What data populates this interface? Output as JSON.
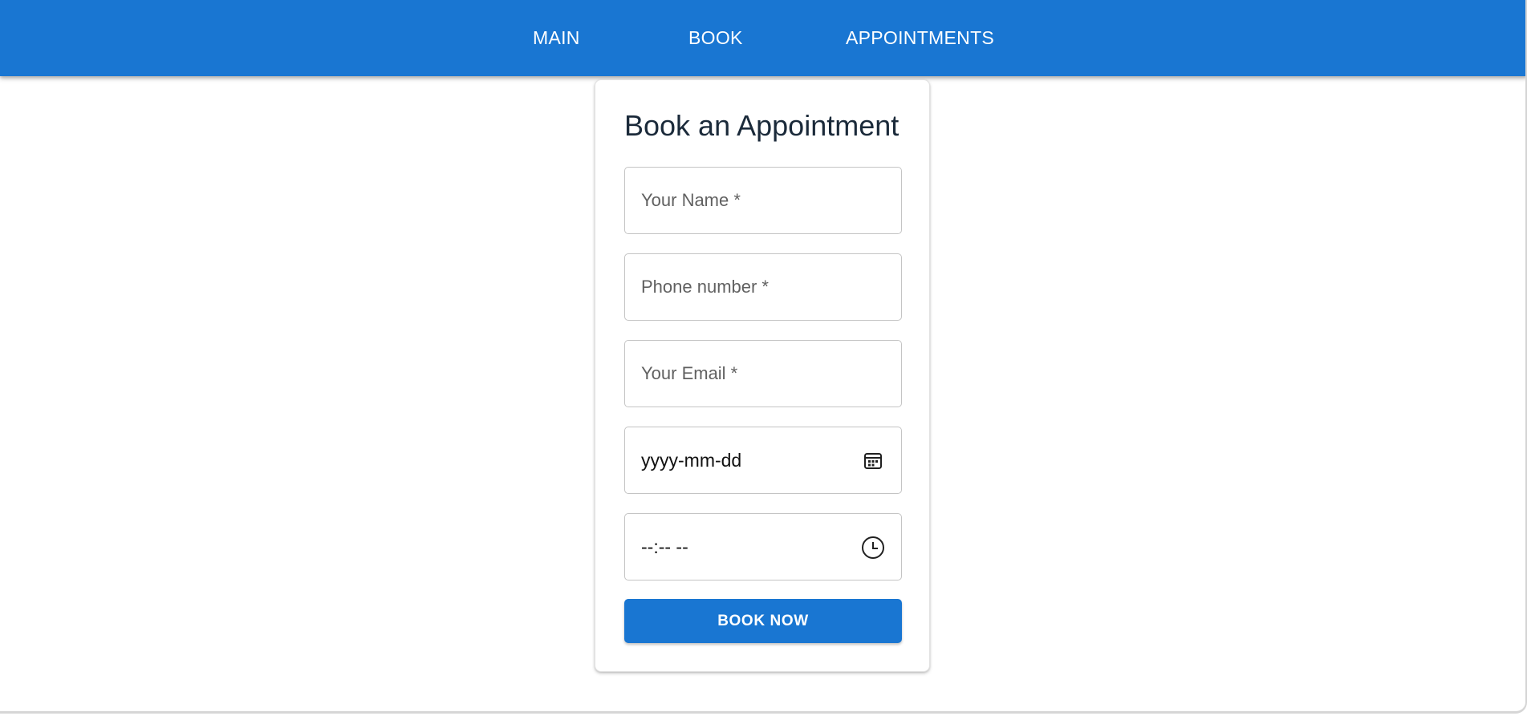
{
  "nav": {
    "links": [
      {
        "label": "MAIN"
      },
      {
        "label": "BOOK"
      },
      {
        "label": "APPOINTMENTS"
      }
    ],
    "background": "#1976d2"
  },
  "form": {
    "title": "Book an Appointment",
    "fields": {
      "name": {
        "placeholder": "Your Name *",
        "value": ""
      },
      "phone": {
        "placeholder": "Phone number *",
        "value": ""
      },
      "email": {
        "placeholder": "Your Email *",
        "value": ""
      },
      "date": {
        "display": "yyyy-mm-dd",
        "icon": "calendar-icon"
      },
      "time": {
        "display": "--:-- --",
        "icon": "clock-icon"
      }
    },
    "submit_label": "BOOK NOW",
    "accent": "#1976d2"
  }
}
